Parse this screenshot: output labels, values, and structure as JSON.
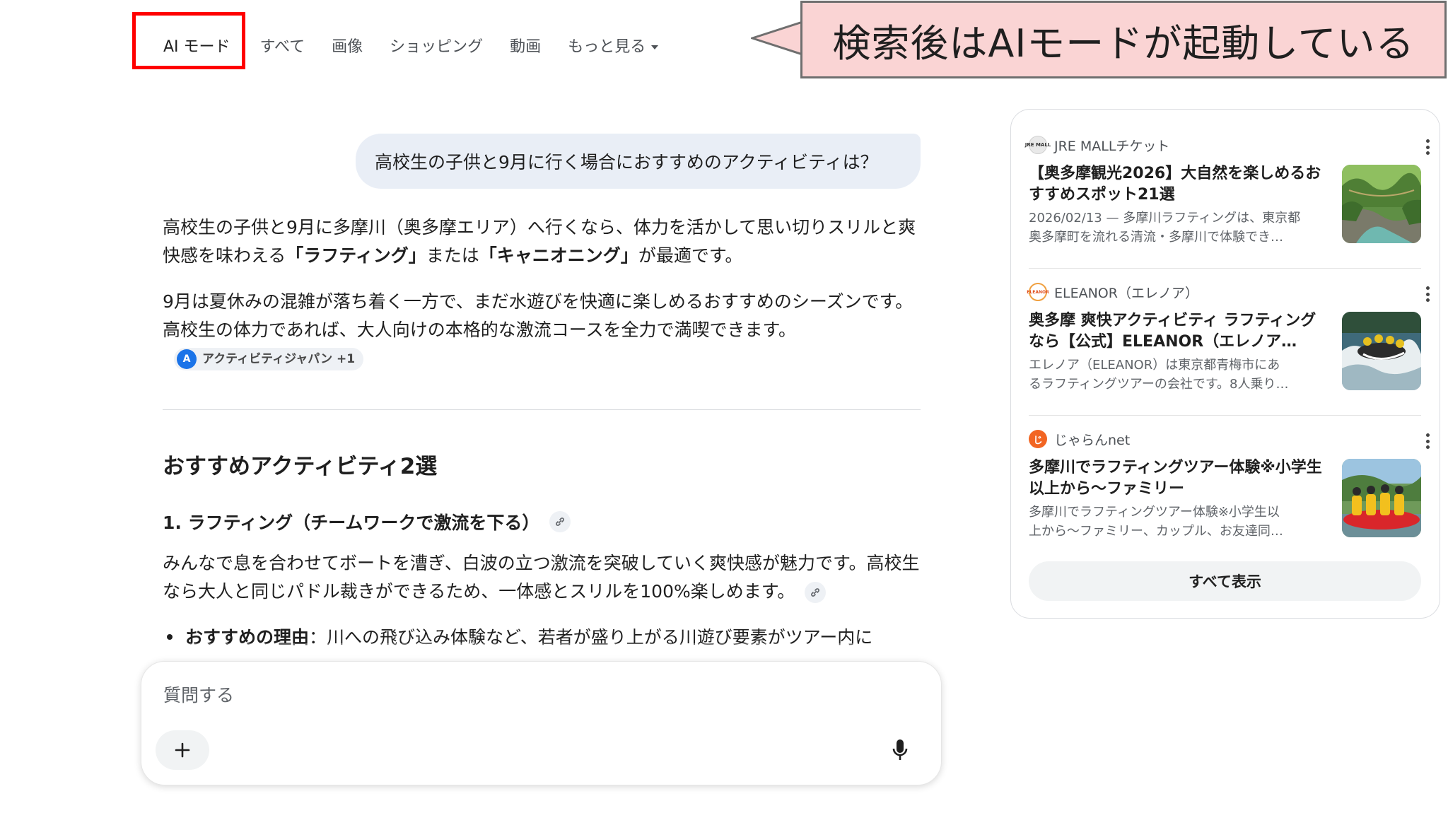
{
  "tabs": [
    {
      "label": "AI モード",
      "active": true
    },
    {
      "label": "すべて"
    },
    {
      "label": "画像"
    },
    {
      "label": "ショッピング"
    },
    {
      "label": "動画"
    },
    {
      "label": "もっと見る"
    }
  ],
  "callout": {
    "text": "検索後はAIモードが起動している",
    "background_color": "#fad4d4",
    "highlight_color": "#ff0000"
  },
  "query": "高校生の子供と9月に行く場合におすすめのアクティビティは？",
  "answer": {
    "p1_a": "高校生の子供と9月に多摩川（奥多摩エリア）へ行くなら、体力を活かして思い切りスリルと爽快感を味わえる",
    "p1_b1": "「ラフティング」",
    "p1_mid": "または",
    "p1_b2": "「キャニオニング」",
    "p1_c": "が最適です。",
    "p2": "9月は夏休みの混雑が落ち着く一方で、まだ水遊びを快適に楽しめるおすすめのシーズンです。高校生の体力であれば、大人向けの本格的な激流コースを全力で満喫できます。",
    "source_chip": "アクティビティジャパン +1",
    "section_title": "おすすめアクティビティ2選",
    "item1_title": "1. ラフティング（チームワークで激流を下る）",
    "item1_body": "みんなで息を合わせてボートを漕ぎ、白波の立つ激流を突破していく爽快感が魅力です。高校生なら大人と同じパドル裁きができるため、一体感とスリルを100%楽しめます。",
    "bullet_label": "おすすめの理由",
    "bullet_text": "：川への飛び込み体験など、若者が盛り上がる川遊び要素がツアー内に"
  },
  "ask": {
    "placeholder": "質問する"
  },
  "sources": [
    {
      "site": "JRE MALLチケット",
      "favicon_text": "JRE MALL",
      "title": "【奥多摩観光2026】大自然を楽しめるおすすめスポット21選",
      "snippet_1": "2026/02/13 — 多摩川ラフティングは、東京都",
      "snippet_2": "奥多摩町を流れる清流・多摩川で体験でき…",
      "image": "gorge-bridge-image"
    },
    {
      "site": "ELEANOR（エレノア）",
      "favicon_text": "ELEANOR",
      "title": "奥多摩 爽快アクティビティ ラフティングなら【公式】ELEANOR（エレノア…",
      "snippet_1": "エレノア（ELEANOR）は東京都青梅市にあ",
      "snippet_2": "るラフティングツアーの会社です。8人乗り…",
      "image": "rafting-rapids-image"
    },
    {
      "site": "じゃらんnet",
      "favicon_text": "じ",
      "title": "多摩川でラフティングツアー体験※小学生以上から～ファミリー",
      "snippet_1": "多摩川でラフティングツアー体験※小学生以",
      "snippet_2": "上から～ファミリー、カップル、お友達同…",
      "image": "rafting-group-image"
    }
  ],
  "show_all": "すべて表示"
}
